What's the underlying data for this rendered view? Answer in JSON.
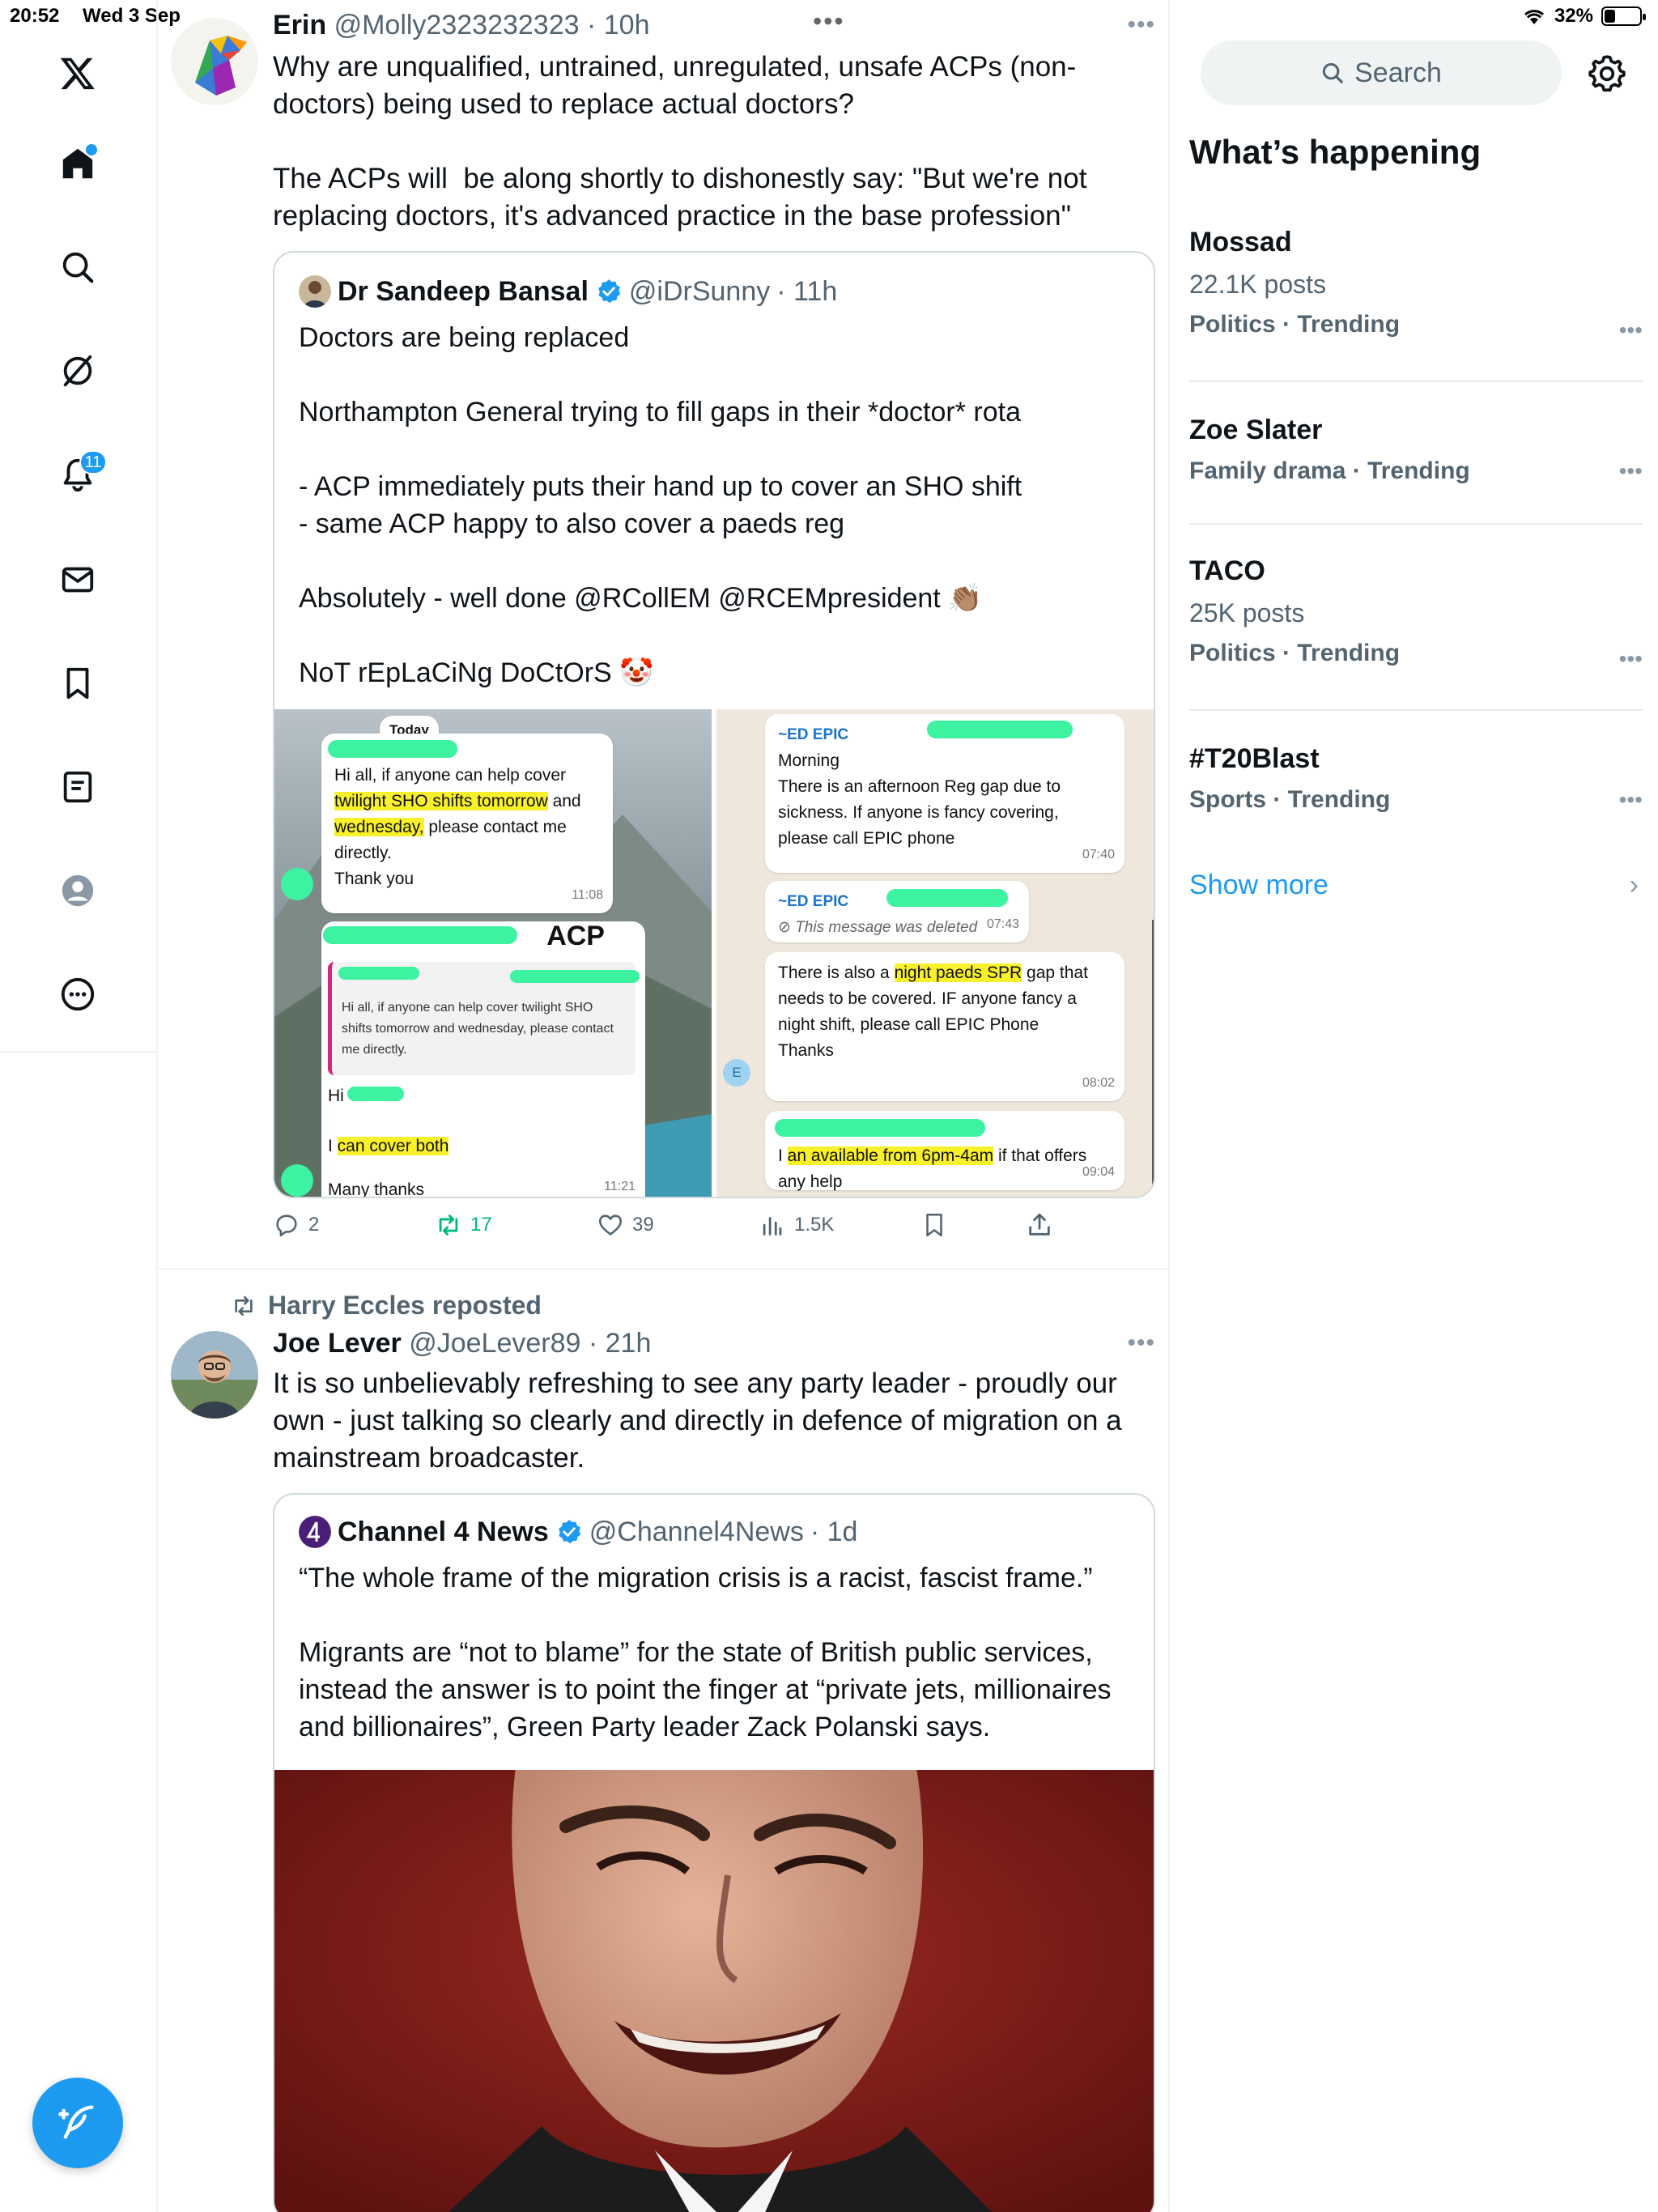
{
  "status": {
    "time": "20:52",
    "date": "Wed 3 Sep",
    "battery": "32%",
    "battery_level": 0.32
  },
  "nav": {
    "notifications_badge": "11"
  },
  "tweet1": {
    "name": "Erin",
    "handle": "@Molly2323232323",
    "time": "· 10h",
    "text": "Why are unqualified, untrained, unregulated, unsafe ACPs (non-doctors) being used to replace actual doctors?\n\nThe ACPs will  be along shortly to dishonestly say: \"But we're not replacing doctors, it's advanced practice in the base profession\"",
    "quote": {
      "name": "Dr Sandeep Bansal",
      "handle": "@iDrSunny",
      "time": "· 11h",
      "text": "Doctors are being replaced\n\nNorthampton General trying to fill gaps in their *doctor* rota\n\n- ACP immediately puts their hand up to cover an SHO shift\n- same ACP happy to also cover a paeds reg\n\nAbsolutely - well done @RCollEM @RCEMpresident 👏🏽\n\nNoT rEpLaCiNg DoCtOrS 🤡"
    },
    "image_left": {
      "day": "Today",
      "msg1_a": "Hi all, if anyone can help cover ",
      "msg1_hl1": "twilight SHO shifts tomorrow",
      "msg1_b": " and ",
      "msg1_hl2": "wednesday,",
      "msg1_c": " please contact me directly.",
      "msg1_d": "Thank you",
      "msg1_time": "11:08",
      "acp": "ACP",
      "reply_quote": "Hi all, if anyone can help cover twilight SHO shifts tomorrow and wednesday, please contact me directly.",
      "hi": "Hi",
      "cover_a": "I ",
      "cover_hl": "can cover both",
      "thanks": "Many thanks",
      "msg2_time": "11:21"
    },
    "image_right": {
      "sender": "~ED EPIC",
      "m1": "Morning\nThere is an afternoon Reg gap due to sickness. If anyone is fancy covering, please call EPIC phone",
      "m1_time": "07:40",
      "sender2": "~ED EPIC",
      "deleted": "This message was deleted",
      "deleted_time": "07:43",
      "m3_a": "There is also a ",
      "m3_hl": "night paeds SPR",
      "m3_b": " gap that needs to be covered. IF anyone fancy a night shift, please call EPIC Phone\nThanks",
      "m3_time": "08:02",
      "avatar_letter": "E",
      "m4_a": "I ",
      "m4_hl": "an available from 6pm-4am",
      "m4_b": " if that offers any help",
      "m4_time": "09:04"
    },
    "actions": {
      "replies": "2",
      "reposts": "17",
      "likes": "39",
      "views": "1.5K"
    }
  },
  "tweet2": {
    "repost_by": "Harry Eccles reposted",
    "name": "Joe Lever",
    "handle": "@JoeLever89",
    "time": "· 21h",
    "text": "It is so unbelievably refreshing to see any party leader - proudly our own - just talking so clearly and directly in defence of migration on a mainstream broadcaster.",
    "quote": {
      "name": "Channel 4 News",
      "handle": "@Channel4News",
      "time": "· 1d",
      "text": "“The whole frame of the migration crisis is a racist, fascist frame.”\n\nMigrants are “not to blame” for the state of British public services, instead the answer is to point the finger at “private jets, millionaires and billionaires”, Green Party leader Zack Polanski says."
    }
  },
  "sidebar": {
    "search_placeholder": "Search",
    "heading": "What’s happening",
    "trends": [
      {
        "title": "Mossad",
        "posts": "22.1K posts",
        "category": "Politics · Trending"
      },
      {
        "title": "Zoe Slater",
        "posts": "",
        "category": "Family drama · Trending"
      },
      {
        "title": "TACO",
        "posts": "25K posts",
        "category": "Politics · Trending"
      },
      {
        "title": "#T20Blast",
        "posts": "",
        "category": "Sports · Trending"
      }
    ],
    "show_more": "Show more"
  },
  "colors": {
    "accent": "#1d9bf0",
    "repost_green": "#00ba7c",
    "highlight": "#f7f02a",
    "scribble": "#3df2a0"
  },
  "icons": [
    "x-logo-icon",
    "home-icon",
    "search-icon",
    "grok-icon",
    "bell-icon",
    "mail-icon",
    "bookmark-icon",
    "lists-icon",
    "profile-icon",
    "more-icon",
    "compose-icon",
    "reply-icon",
    "repost-icon",
    "like-icon",
    "views-icon",
    "share-icon",
    "verified-icon",
    "gear-icon",
    "wifi-icon"
  ]
}
